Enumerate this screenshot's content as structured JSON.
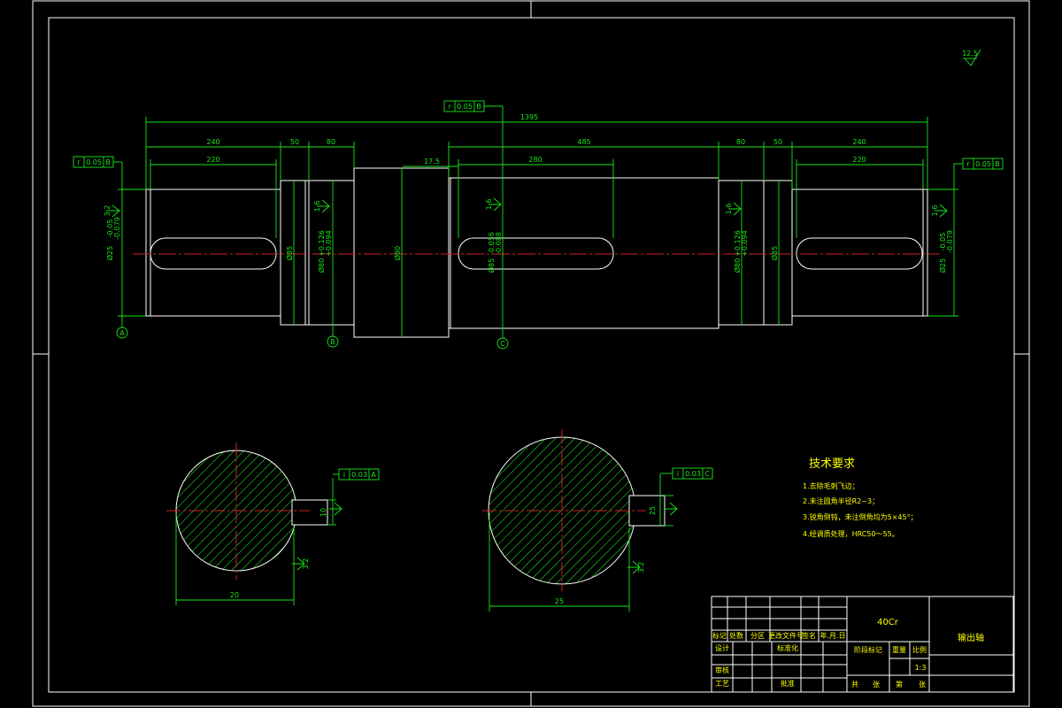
{
  "drawing": {
    "dimensions_top": {
      "overall": "1395",
      "left_240": "240",
      "left_220": "220",
      "d_50a": "50",
      "d_80": "80",
      "d_17_5": "17.5",
      "d_280": "280",
      "d_485": "485",
      "d_80b": "80",
      "d_50b": "50",
      "right_240": "240",
      "right_220": "220"
    },
    "diameters": {
      "left_end": "Ø25",
      "left_end_tol_up": "-0.05",
      "left_end_tol_lo": "-0.079",
      "d85a": "Ø85",
      "bearing_left": "Ø80",
      "bearing_left_tol_up": "+0.126",
      "bearing_left_tol_lo": "+0.094",
      "collar": "Ø80",
      "middle": "Ø85",
      "middle_tol_up": "-0.056",
      "middle_tol_lo": "-0.088",
      "bearing_right": "Ø80",
      "bearing_right_tol_up": "+0.126",
      "bearing_right_tol_lo": "+0.094",
      "d85b": "Ø85",
      "right_end": "Ø25",
      "right_end_tol_up": "-0.05",
      "right_end_tol_lo": "-0.079"
    },
    "tolerance_frames": {
      "top": [
        "r",
        "0.05",
        "B"
      ],
      "left": [
        "r",
        "0.05",
        "B"
      ],
      "right": [
        "r",
        "0.05",
        "B"
      ],
      "section_left": [
        "i",
        "0.03",
        "A"
      ],
      "section_right": [
        "i",
        "0.03",
        "C"
      ]
    },
    "datums": [
      "A",
      "B",
      "C"
    ],
    "roughness": {
      "top_right": "12.5",
      "left_end": "3.2",
      "bearing": "1.6",
      "middle": "1.6",
      "right_bearing": "1.6",
      "right_end": "1.6",
      "key": "3.2"
    },
    "sections": {
      "left_width": "20",
      "left_key_depth": "10",
      "right_width": "25",
      "right_key_depth": "25"
    },
    "tech_req": {
      "title": "技术要求",
      "lines": [
        "1.去除毛刺飞边；",
        "2.未注圆角半径R2~3；",
        "3.锐角倒钝，未注倒角均为5×45°；",
        "4.经调质处理，HRC50～55。"
      ]
    }
  },
  "title_block": {
    "material": "40Cr",
    "part_name": "输出轴",
    "header_cells": [
      "标记",
      "处数",
      "分区",
      "更改文件号",
      "签名",
      "年.月.日"
    ],
    "row_labels": [
      "设计",
      "审核",
      "工艺"
    ],
    "mid_labels": [
      "标准化",
      "批准"
    ],
    "stage_label": "阶段标记",
    "weight_label": "重量",
    "scale_label": "比例",
    "scale_value": "1:3",
    "sheet_labels": [
      "共",
      "张",
      "第",
      "张"
    ]
  }
}
